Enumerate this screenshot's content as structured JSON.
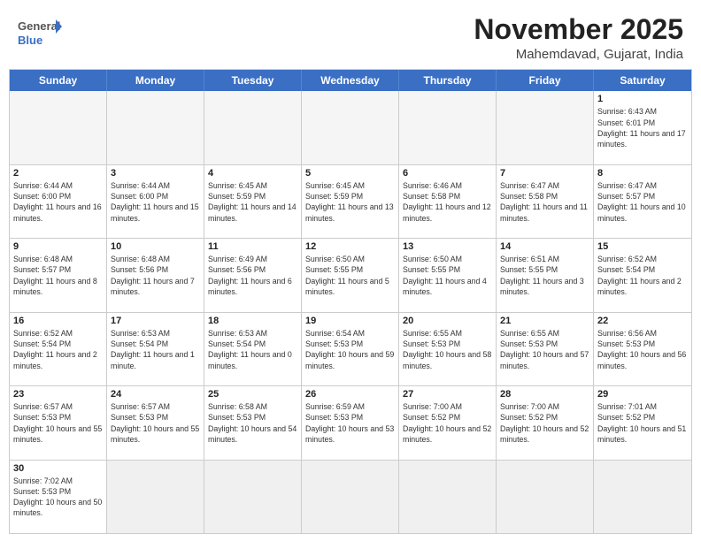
{
  "header": {
    "logo_general": "General",
    "logo_blue": "Blue",
    "title": "November 2025",
    "subtitle": "Mahemdavad, Gujarat, India"
  },
  "weekdays": [
    "Sunday",
    "Monday",
    "Tuesday",
    "Wednesday",
    "Thursday",
    "Friday",
    "Saturday"
  ],
  "weeks": [
    [
      {
        "day": "",
        "empty": true
      },
      {
        "day": "",
        "empty": true
      },
      {
        "day": "",
        "empty": true
      },
      {
        "day": "",
        "empty": true
      },
      {
        "day": "",
        "empty": true
      },
      {
        "day": "",
        "empty": true
      },
      {
        "day": "1",
        "sunrise": "6:43 AM",
        "sunset": "6:01 PM",
        "daylight": "11 hours and 17 minutes."
      }
    ],
    [
      {
        "day": "2",
        "sunrise": "6:44 AM",
        "sunset": "6:00 PM",
        "daylight": "11 hours and 16 minutes."
      },
      {
        "day": "3",
        "sunrise": "6:44 AM",
        "sunset": "6:00 PM",
        "daylight": "11 hours and 15 minutes."
      },
      {
        "day": "4",
        "sunrise": "6:45 AM",
        "sunset": "5:59 PM",
        "daylight": "11 hours and 14 minutes."
      },
      {
        "day": "5",
        "sunrise": "6:45 AM",
        "sunset": "5:59 PM",
        "daylight": "11 hours and 13 minutes."
      },
      {
        "day": "6",
        "sunrise": "6:46 AM",
        "sunset": "5:58 PM",
        "daylight": "11 hours and 12 minutes."
      },
      {
        "day": "7",
        "sunrise": "6:47 AM",
        "sunset": "5:58 PM",
        "daylight": "11 hours and 11 minutes."
      },
      {
        "day": "8",
        "sunrise": "6:47 AM",
        "sunset": "5:57 PM",
        "daylight": "11 hours and 10 minutes."
      }
    ],
    [
      {
        "day": "9",
        "sunrise": "6:48 AM",
        "sunset": "5:57 PM",
        "daylight": "11 hours and 8 minutes."
      },
      {
        "day": "10",
        "sunrise": "6:48 AM",
        "sunset": "5:56 PM",
        "daylight": "11 hours and 7 minutes."
      },
      {
        "day": "11",
        "sunrise": "6:49 AM",
        "sunset": "5:56 PM",
        "daylight": "11 hours and 6 minutes."
      },
      {
        "day": "12",
        "sunrise": "6:50 AM",
        "sunset": "5:55 PM",
        "daylight": "11 hours and 5 minutes."
      },
      {
        "day": "13",
        "sunrise": "6:50 AM",
        "sunset": "5:55 PM",
        "daylight": "11 hours and 4 minutes."
      },
      {
        "day": "14",
        "sunrise": "6:51 AM",
        "sunset": "5:55 PM",
        "daylight": "11 hours and 3 minutes."
      },
      {
        "day": "15",
        "sunrise": "6:52 AM",
        "sunset": "5:54 PM",
        "daylight": "11 hours and 2 minutes."
      }
    ],
    [
      {
        "day": "16",
        "sunrise": "6:52 AM",
        "sunset": "5:54 PM",
        "daylight": "11 hours and 2 minutes."
      },
      {
        "day": "17",
        "sunrise": "6:53 AM",
        "sunset": "5:54 PM",
        "daylight": "11 hours and 1 minute."
      },
      {
        "day": "18",
        "sunrise": "6:53 AM",
        "sunset": "5:54 PM",
        "daylight": "11 hours and 0 minutes."
      },
      {
        "day": "19",
        "sunrise": "6:54 AM",
        "sunset": "5:53 PM",
        "daylight": "10 hours and 59 minutes."
      },
      {
        "day": "20",
        "sunrise": "6:55 AM",
        "sunset": "5:53 PM",
        "daylight": "10 hours and 58 minutes."
      },
      {
        "day": "21",
        "sunrise": "6:55 AM",
        "sunset": "5:53 PM",
        "daylight": "10 hours and 57 minutes."
      },
      {
        "day": "22",
        "sunrise": "6:56 AM",
        "sunset": "5:53 PM",
        "daylight": "10 hours and 56 minutes."
      }
    ],
    [
      {
        "day": "23",
        "sunrise": "6:57 AM",
        "sunset": "5:53 PM",
        "daylight": "10 hours and 55 minutes."
      },
      {
        "day": "24",
        "sunrise": "6:57 AM",
        "sunset": "5:53 PM",
        "daylight": "10 hours and 55 minutes."
      },
      {
        "day": "25",
        "sunrise": "6:58 AM",
        "sunset": "5:53 PM",
        "daylight": "10 hours and 54 minutes."
      },
      {
        "day": "26",
        "sunrise": "6:59 AM",
        "sunset": "5:53 PM",
        "daylight": "10 hours and 53 minutes."
      },
      {
        "day": "27",
        "sunrise": "7:00 AM",
        "sunset": "5:52 PM",
        "daylight": "10 hours and 52 minutes."
      },
      {
        "day": "28",
        "sunrise": "7:00 AM",
        "sunset": "5:52 PM",
        "daylight": "10 hours and 52 minutes."
      },
      {
        "day": "29",
        "sunrise": "7:01 AM",
        "sunset": "5:52 PM",
        "daylight": "10 hours and 51 minutes."
      }
    ],
    [
      {
        "day": "30",
        "sunrise": "7:02 AM",
        "sunset": "5:53 PM",
        "daylight": "10 hours and 50 minutes."
      },
      {
        "day": "",
        "empty": true
      },
      {
        "day": "",
        "empty": true
      },
      {
        "day": "",
        "empty": true
      },
      {
        "day": "",
        "empty": true
      },
      {
        "day": "",
        "empty": true
      },
      {
        "day": "",
        "empty": true
      }
    ]
  ]
}
